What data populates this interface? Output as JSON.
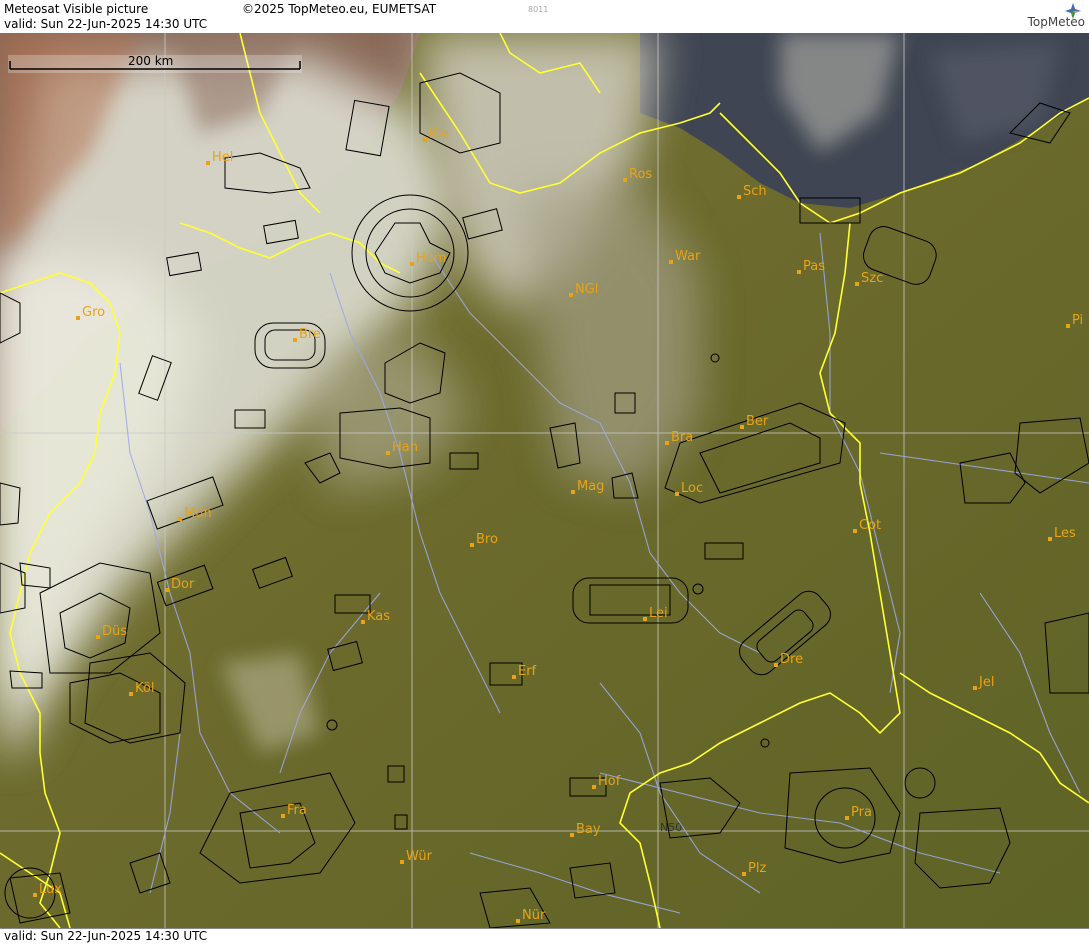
{
  "header": {
    "title": "Meteosat Visible picture",
    "copyright": "©2025 TopMeteo.eu, EUMETSAT",
    "code": "8011",
    "valid": "valid:  Sun  22-Jun-2025  14:30 UTC"
  },
  "logo": {
    "text": "TopMeteo"
  },
  "footer": {
    "valid": "valid:  Sun  22-Jun-2025  14:30 UTC"
  },
  "scale": {
    "label": "200 km"
  },
  "grid": {
    "label": "N50"
  },
  "colors": {
    "land": "#6b6a2c",
    "sea": "#3d4450",
    "cloud": "#e8e6dc",
    "border": "#ffff33",
    "river": "#9da8e6",
    "airspace": "#000000",
    "city": "#e8a317"
  },
  "cities": [
    {
      "name": "Kie"
    },
    {
      "name": "Hel"
    },
    {
      "name": "Ros"
    },
    {
      "name": "Sch"
    },
    {
      "name": "Ham"
    },
    {
      "name": "War"
    },
    {
      "name": "Pas"
    },
    {
      "name": "Szc"
    },
    {
      "name": "NGl"
    },
    {
      "name": "Gro"
    },
    {
      "name": "Bre"
    },
    {
      "name": "Pi"
    },
    {
      "name": "Ber"
    },
    {
      "name": "Bra"
    },
    {
      "name": "Han"
    },
    {
      "name": "Mag"
    },
    {
      "name": "Loc"
    },
    {
      "name": "Mün"
    },
    {
      "name": "Cot"
    },
    {
      "name": "Bro"
    },
    {
      "name": "Les"
    },
    {
      "name": "Dor"
    },
    {
      "name": "Kas"
    },
    {
      "name": "Lei"
    },
    {
      "name": "Düs"
    },
    {
      "name": "Dre"
    },
    {
      "name": "Erf"
    },
    {
      "name": "Köl"
    },
    {
      "name": "Jel"
    },
    {
      "name": "Hof"
    },
    {
      "name": "Fra"
    },
    {
      "name": "Pra"
    },
    {
      "name": "Bay"
    },
    {
      "name": "Wür"
    },
    {
      "name": "Plz"
    },
    {
      "name": "Lux"
    },
    {
      "name": "Nür"
    }
  ]
}
